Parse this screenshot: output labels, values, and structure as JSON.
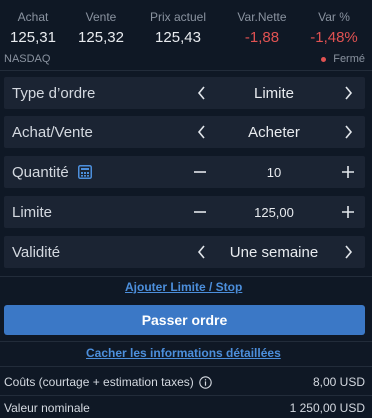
{
  "quote": {
    "columns": [
      {
        "label": "Achat",
        "value": "125,31",
        "negative": false
      },
      {
        "label": "Vente",
        "value": "125,32",
        "negative": false
      },
      {
        "label": "Prix actuel",
        "value": "125,43",
        "negative": false
      },
      {
        "label": "Var.Nette",
        "value": "-1,88",
        "negative": true
      },
      {
        "label": "Var %",
        "value": "-1,48%",
        "negative": true
      }
    ],
    "exchange": "NASDAQ",
    "status": "Fermé",
    "colors": {
      "negative": "#e05252",
      "status_dot": "#e05252"
    }
  },
  "order": {
    "type": {
      "label": "Type d’ordre",
      "value": "Limite"
    },
    "side": {
      "label": "Achat/Vente",
      "value": "Acheter"
    },
    "quantity": {
      "label": "Quantité",
      "value": "10"
    },
    "limit": {
      "label": "Limite",
      "value": "125,00"
    },
    "validity": {
      "label": "Validité",
      "value": "Une semaine"
    }
  },
  "links": {
    "add_limit_stop": "Ajouter Limite / Stop",
    "hide_details": "Cacher les informations détaillées"
  },
  "submit_label": "Passer ordre",
  "details": {
    "costs": {
      "label": "Coûts (courtage + estimation taxes)",
      "value": "8,00 USD"
    },
    "nominal": {
      "label": "Valeur nominale",
      "value": "1 250,00 USD"
    }
  },
  "icons": {
    "prev": "chevron-left-icon",
    "next": "chevron-right-icon",
    "minus": "minus-icon",
    "plus": "plus-icon",
    "calculator": "calculator-icon",
    "info": "info-icon"
  },
  "colors": {
    "background": "#0f1825",
    "row_background": "#1b2433",
    "accent": "#3b78c6",
    "link": "#4c8fdc"
  }
}
